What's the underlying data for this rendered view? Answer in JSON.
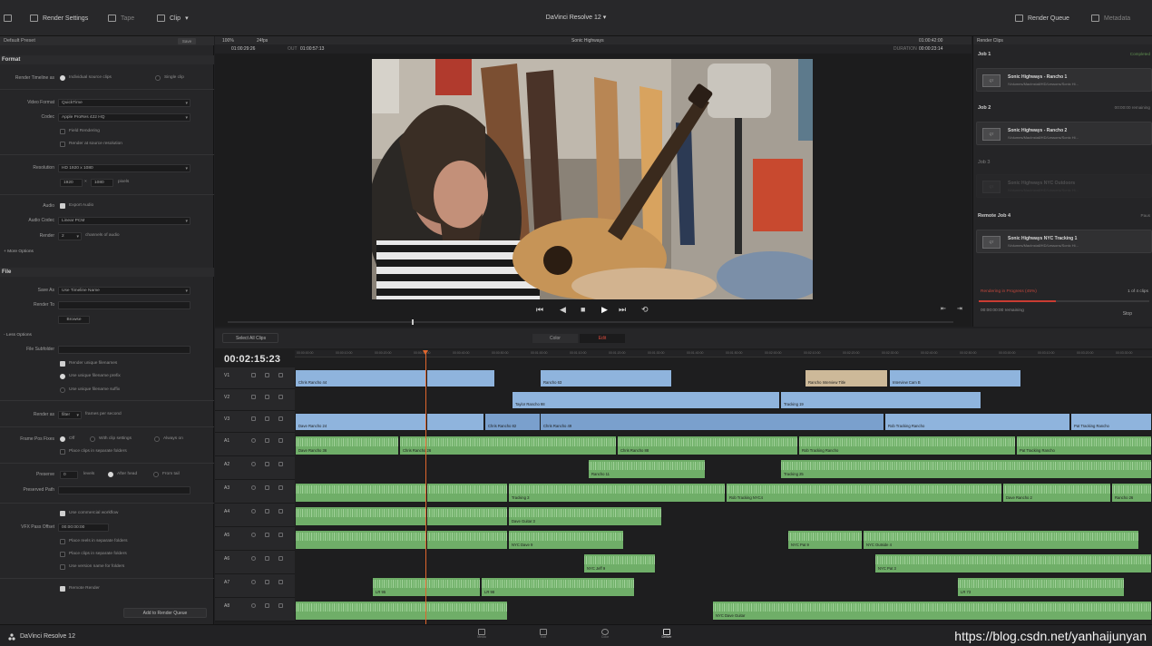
{
  "topbar": {
    "render_settings": "Render Settings",
    "tape": "Tape",
    "clip": "Clip",
    "title": "DaVinci Resolve 12",
    "render_queue": "Render Queue",
    "metadata": "Metadata"
  },
  "left_panel": {
    "preset": "Default Preset",
    "save": "Save",
    "format_title": "Format",
    "render_timeline_as_label": "Render Timeline as",
    "individual_source_clips": "Individual source clips",
    "single_clip": "Single clip",
    "video_format_label": "Video Format",
    "video_format": "QuickTime",
    "codec_label": "Codec",
    "codec": "Apple ProRes 422 HQ",
    "field_rendering": "Field Rendering",
    "render_at_source_resolution": "Render at source resolution",
    "resolution_label": "Resolution",
    "resolution": "HD 1920 x 1080",
    "width": "1920",
    "height": "1080",
    "pixels": "pixels",
    "audio_label": "Audio",
    "export_audio": "Export Audio",
    "audio_codec_label": "Audio Codec",
    "audio_codec": "Linear PCM",
    "render_label": "Render",
    "render_channels": "2",
    "channels_of_audio": "channels of audio",
    "more_options": "+ More Options",
    "file_title": "File",
    "save_as_label": "Save As",
    "save_as": "Use Timeline Name",
    "render_to_label": "Render To",
    "browse": "Browse",
    "less_options": "- Less Options",
    "file_subfolder_label": "File Subfolder",
    "render_unique_filenames": "Render unique filenames",
    "use_unique_filename_prefix": "Use unique filename prefix",
    "use_unique_filename_suffix": "Use unique filename suffix",
    "render_as_label": "Render as",
    "render_as": "filter",
    "frames_per_second": "frames per second",
    "frame_pos_label": "Frame Pos Fixes",
    "off": "Off",
    "with_clip_settings": "With clip settings",
    "always_on": "Always on",
    "place_clips_in_separate_folders": "Place clips in separate folders",
    "preserve_label": "Preserve",
    "preserve_value": "0",
    "levels": "levels",
    "after_head": "After head",
    "from_tail": "From tail",
    "preserved_path_label": "Preserved Path",
    "use_commercial_workflow": "Use commercial workflow",
    "vfx_pass_offset_label": "VFX Pass Offset",
    "vfx_pass_offset": "00:00:00:00",
    "place_reels_in_separate_folders": "Place reels in separate folders",
    "place_clips_in_separate_folders_2": "Place clips in separate folders",
    "use_version_name_for_folders": "Use version name for folders",
    "remote_render": "Remote Render",
    "add_to_render_queue": "Add to Render Queue"
  },
  "viewer": {
    "zoom": "100%",
    "fps": "24fps",
    "clip_name": "Sonic Highways",
    "tc_right": "01:00:42:00",
    "src_in": "01:00:29:26",
    "out_label": "OUT",
    "src_out": "01:00:57:13",
    "duration_label": "DURATION",
    "duration": "00:00:23:14"
  },
  "render_queue": {
    "header": "Render Clips",
    "jobs": [
      {
        "title": "Job 1",
        "right": "Completed",
        "name": "Sonic Highways - Rancho 1",
        "path": "/Volumes/MacInstall/HD/Lessons/Sonic Hi..."
      },
      {
        "title": "Job 2",
        "right": "00:00:00 remaining",
        "name": "Sonic Highways - Rancho 2",
        "path": "/Volumes/MacInstall/HD/Lessons/Sonic Hi..."
      },
      {
        "title": "Job 3",
        "right": "",
        "name": "Sonic Highways NYC Outdoors",
        "path": "/Volumes/MacInstall/HD/Lessons/Sonic Hi..."
      },
      {
        "title": "Remote Job 4",
        "right": "Paus",
        "name": "Sonic Highways NYC Tracking 1",
        "path": "/Volumes/MacInstall/HD/Lessons/Sonic Hi..."
      }
    ],
    "status": "Rendering in Progress (45%)",
    "clip_count": "1 of 4 clips",
    "remaining": "00:00:00:00 remaining",
    "stop": "Stop",
    "progress": 0.45
  },
  "timeline": {
    "timecode": "00:02:15:23",
    "select_all_clips": "Select All Clips",
    "color_btn": "Color",
    "edit_btn": "Edit",
    "tracks": [
      "V1",
      "V2",
      "V3",
      "A1",
      "A2",
      "A3",
      "A4",
      "A5",
      "A6",
      "A7",
      "A8"
    ],
    "ruler": [
      "00:00:00:00",
      "00:00:10:00",
      "00:00:20:00",
      "00:00:30:00",
      "00:00:40:00",
      "00:00:50:00",
      "00:01:00:00",
      "00:01:10:00",
      "00:01:20:00",
      "00:01:30:00",
      "00:01:40:00",
      "00:01:50:00",
      "00:02:00:00",
      "00:02:10:00",
      "00:02:20:00",
      "00:02:30:00",
      "00:02:40:00",
      "00:02:50:00",
      "00:03:00:00",
      "00:03:10:00",
      "00:03:20:00",
      "00:03:30:00"
    ],
    "clips": {
      "chris_rancho_44": "Chris Rancho 44",
      "rancho_63": "Rancho 63",
      "rancho_interview_title": "Rancho Interview Title",
      "interview_cam_b": "Interview Cam B",
      "taylor_rancho_98": "Taylor Rancho 98",
      "tracking_19": "Tracking 19",
      "dave_rancho_24": "Dave Rancho 24",
      "chris_rancho_82": "Chris Rancho 82",
      "chris_rancho_49": "Chris Rancho 49",
      "rob_tracking_rancho": "Rob Tracking Rancho",
      "pat_tracking_rancho": "Pat Tracking Rancho",
      "dave_rancho_36": "Dave Rancho 36",
      "chris_rancho_26": "Chris Rancho 26",
      "chris_rancho_88": "Chris Rancho 88",
      "rob_tracking_rancho_a1": "Rob Tracking Rancho",
      "pat_tracking_rancho_a1": "Pat Tracking Rancho",
      "rancho_11": "Rancho 11",
      "tracking_25": "Tracking 25",
      "tracking_3": "Tracking 3",
      "rob_tracking_nyc4": "Rob Tracking NYC4",
      "dave_rancho_2": "Dave Rancho 2",
      "rancho_26": "Rancho 26",
      "dave_guitar_3": "Dave Guitar 3",
      "nyc_dave_9": "NYC Dave 9",
      "nyc_pat_9": "NYC Pat 9",
      "nyc_outside_4": "NYC Outside 4",
      "nyc_jeff_9": "NYC Jeff 9",
      "nyc_pat_3": "NYC Pat 3",
      "lr_95": "LR 95",
      "lr_98": "LR 98",
      "lr_73": "LR 73",
      "nyc_dave_guitar": "NYC Dave Guitar"
    }
  },
  "bottom": {
    "app_name": "DaVinci Resolve 12",
    "pages": [
      "Media",
      "Edit",
      "Color",
      "Deliver"
    ]
  },
  "watermark": "https://blog.csdn.net/yanhaijunyan"
}
